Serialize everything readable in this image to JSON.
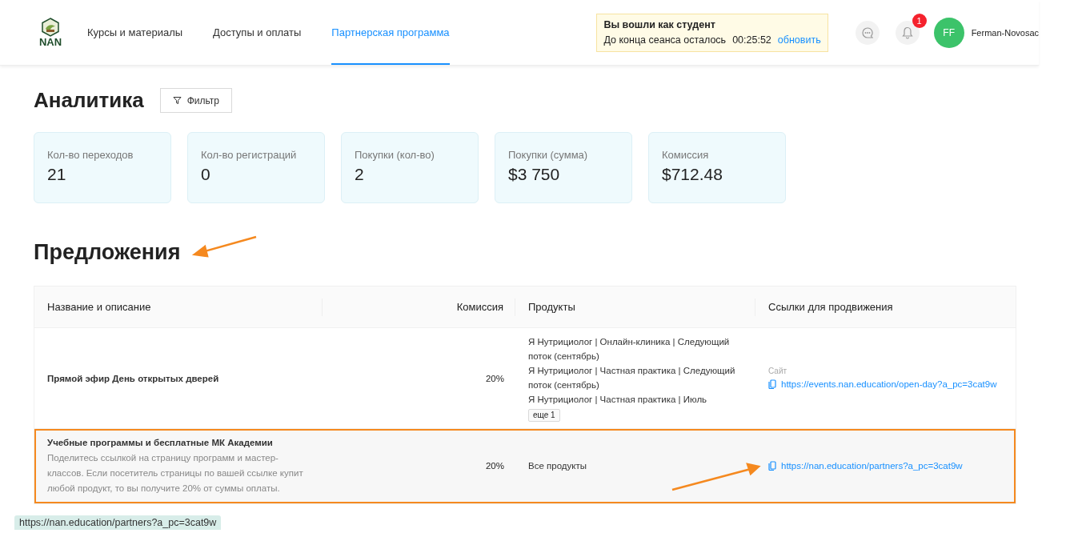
{
  "header": {
    "logo_text": "NAN",
    "nav": [
      {
        "label": "Курсы и материалы",
        "selected": false
      },
      {
        "label": "Доступы и оплаты",
        "selected": false
      },
      {
        "label": "Партнерская программа",
        "selected": true
      }
    ],
    "session": {
      "title": "Вы вошли как студент",
      "text": "До конца сеанса осталось",
      "timer": "00:25:52",
      "refresh": "обновить"
    },
    "notifications": {
      "count": "1"
    },
    "user": {
      "initials": "FF",
      "name": "Ferman-Novosac"
    }
  },
  "analytics": {
    "title": "Аналитика",
    "filter_button": "Фильтр",
    "stats": [
      {
        "label": "Кол-во переходов",
        "value": "21"
      },
      {
        "label": "Кол-во регистраций",
        "value": "0"
      },
      {
        "label": "Покупки (кол-во)",
        "value": "2"
      },
      {
        "label": "Покупки (сумма)",
        "value": "$3 750"
      },
      {
        "label": "Комиссия",
        "value": "$712.48"
      }
    ]
  },
  "offers": {
    "title": "Предложения",
    "columns": [
      "Название и описание",
      "Комиссия",
      "Продукты",
      "Ссылки для продвижения"
    ],
    "rows": [
      {
        "name": "Прямой эфир День открытых дверей",
        "commission": "20%",
        "products": [
          "Я Нутрициолог | Онлайн-клиника | Следующий поток (сентябрь)",
          "Я Нутрициолог | Частная практика | Следующий поток (сентябрь)",
          "Я Нутрициолог | Частная практика | Июль"
        ],
        "more_tag": "еще 1",
        "link_label": "Сайт",
        "link": "https://events.nan.education/open-day?a_pc=3cat9w",
        "hovered": false,
        "outlined": false
      },
      {
        "name": "Учебные программы и бесплатные МК Академии",
        "description": "Поделитесь ссылкой на страницу программ и мастер-классов. Если посетитель страницы по вашей ссылке купит любой продукт, то вы получите 20% от суммы оплаты.",
        "commission": "20%",
        "products": [
          "Все продукты"
        ],
        "link": "https://nan.education/partners?a_pc=3cat9w",
        "hovered": true,
        "outlined": true
      }
    ]
  },
  "status_bar": {
    "url": "https://nan.education/partners?a_pc=3cat9w"
  }
}
